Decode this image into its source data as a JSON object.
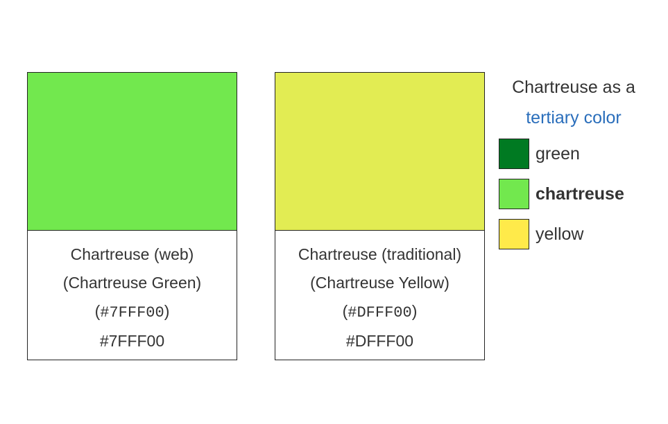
{
  "cards": [
    {
      "color": "#72E84E",
      "lines": [
        "Chartreuse (web)",
        "(Chartreuse Green)",
        "(#7FFF00)",
        "#7FFF00"
      ]
    },
    {
      "color": "#E2EC53",
      "lines": [
        "Chartreuse (traditional)",
        "(Chartreuse Yellow)",
        "(#DFFF00)",
        "#DFFF00"
      ]
    }
  ],
  "legend": {
    "title_prefix": "Chartreuse as a",
    "title_link": "tertiary color",
    "items": [
      {
        "label": "green",
        "color": "#007A22",
        "bold": false
      },
      {
        "label": "chartreuse",
        "color": "#72E84E",
        "bold": true
      },
      {
        "label": "yellow",
        "color": "#FFEA4A",
        "bold": false
      }
    ]
  }
}
